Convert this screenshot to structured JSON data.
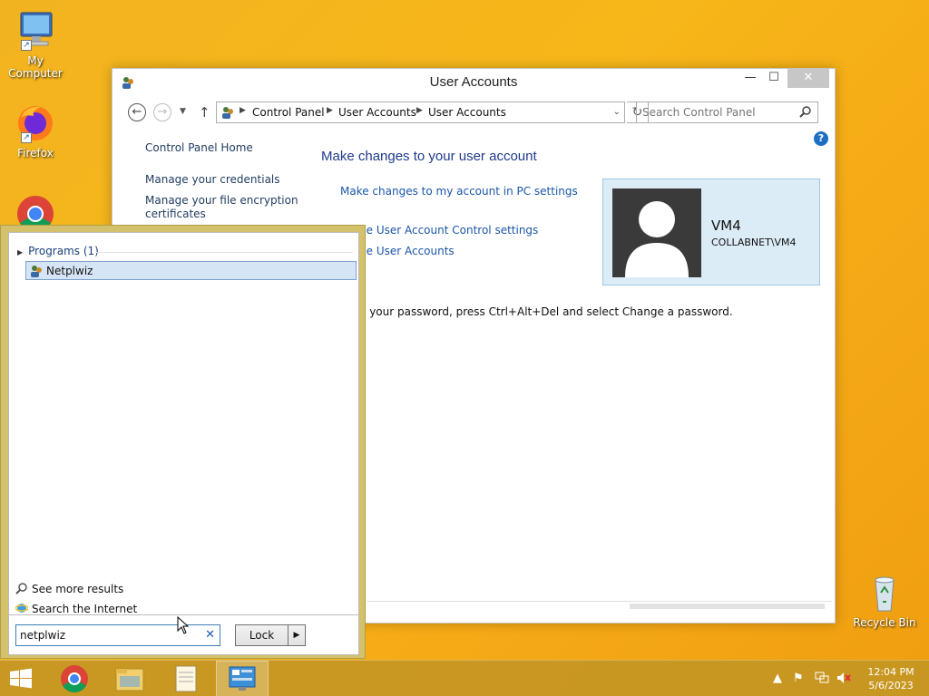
{
  "desktop": {
    "icons": [
      {
        "label": "My Computer",
        "icon": "computer-icon"
      },
      {
        "label": "Firefox",
        "icon": "firefox-icon"
      },
      {
        "label": "Google Chrome",
        "icon": "chrome-icon"
      },
      {
        "label": "Recycle Bin",
        "icon": "recycle-bin-icon"
      }
    ]
  },
  "window": {
    "title": "User Accounts",
    "controls": {
      "minimize": "—",
      "maximize": "☐",
      "close": "✕"
    },
    "breadcrumb": [
      "Control Panel",
      "User Accounts",
      "User Accounts"
    ],
    "search_placeholder": "Search Control Panel",
    "help": "?",
    "left_pane": {
      "home": "Control Panel Home",
      "links": [
        "Manage your credentials",
        "Manage your file encryption certificates"
      ]
    },
    "main": {
      "heading": "Make changes to your user account",
      "link_pc_settings": "Make changes to my account in PC settings",
      "link_uac": "ge User Account Control settings",
      "link_manage": "ge User Accounts",
      "password_note": "e your password, press Ctrl+Alt+Del and select Change a password."
    },
    "user": {
      "name": "VM4",
      "domain": "COLLABNET\\VM4"
    }
  },
  "start_menu": {
    "programs_header": "Programs (1)",
    "results": [
      {
        "label": "Netplwiz",
        "icon": "netplwiz-icon"
      }
    ],
    "see_more": "See more results",
    "search_internet": "Search the Internet",
    "search_value": "netplwiz",
    "clear": "✕",
    "lock_label": "Lock",
    "lock_arrow": "▶"
  },
  "taskbar": {
    "items": [
      "start-button",
      "chrome",
      "file-explorer",
      "notepad",
      "control-panel"
    ],
    "active_item": "control-panel",
    "clock_time": "12:04 PM",
    "clock_date": "5/6/2023"
  }
}
